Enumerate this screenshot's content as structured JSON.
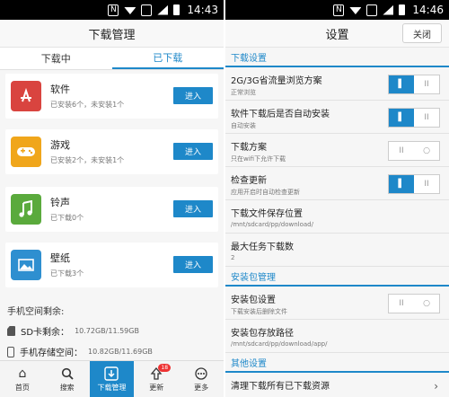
{
  "left": {
    "status_time": "14:43",
    "title": "下载管理",
    "tabs": [
      {
        "label": "下载中"
      },
      {
        "label": "已下载"
      }
    ],
    "categories": [
      {
        "name": "软件",
        "info": "已安装6个，未安装1个",
        "button": "进入",
        "color": "#d9443f",
        "icon": "app-store-icon"
      },
      {
        "name": "游戏",
        "info": "已安装2个，未安装1个",
        "button": "进入",
        "color": "#f0a61b",
        "icon": "gamepad-icon"
      },
      {
        "name": "铃声",
        "info": "已下载0个",
        "button": "进入",
        "color": "#5aaa3c",
        "icon": "music-note-icon"
      },
      {
        "name": "壁纸",
        "info": "已下载3个",
        "button": "进入",
        "color": "#2e8fd0",
        "icon": "image-icon"
      }
    ],
    "storage": {
      "title": "手机空间剩余:",
      "sd_label": "SD卡剩余：",
      "sd_value": "10.72GB/11.59GB",
      "phone_label": "手机存储空间：",
      "phone_value": "10.82GB/11.69GB"
    },
    "nav": [
      {
        "label": "首页",
        "icon": "home-icon"
      },
      {
        "label": "搜索",
        "icon": "search-icon"
      },
      {
        "label": "下载管理",
        "icon": "download-icon"
      },
      {
        "label": "更新",
        "icon": "update-icon",
        "badge": "18"
      },
      {
        "label": "更多",
        "icon": "more-icon"
      }
    ]
  },
  "right": {
    "status_time": "14:46",
    "title": "设置",
    "close_label": "关闭",
    "sections": {
      "download": "下载设置",
      "install": "安装包管理",
      "other": "其他设置"
    },
    "settings": [
      {
        "title": "2G/3G省流量浏览方案",
        "sub": "正常浏览",
        "toggle": true
      },
      {
        "title": "软件下载后是否自动安装",
        "sub": "自动安装",
        "toggle": true
      },
      {
        "title": "下载方案",
        "sub": "只在wifi下允许下载",
        "toggle": false
      },
      {
        "title": "检查更新",
        "sub": "应用开启时自动检查更新",
        "toggle": true
      },
      {
        "title": "下载文件保存位置",
        "sub": "/mnt/sdcard/pp/download/"
      },
      {
        "title": "最大任务下载数",
        "sub": "2"
      }
    ],
    "install_settings": [
      {
        "title": "安装包设置",
        "sub": "下载安装后删除文件",
        "toggle": false
      },
      {
        "title": "安装包存放路径",
        "sub": "/mnt/sdcard/pp/download/app/"
      }
    ],
    "other_settings": [
      {
        "title": "清理下载所有已下载资源"
      }
    ]
  }
}
